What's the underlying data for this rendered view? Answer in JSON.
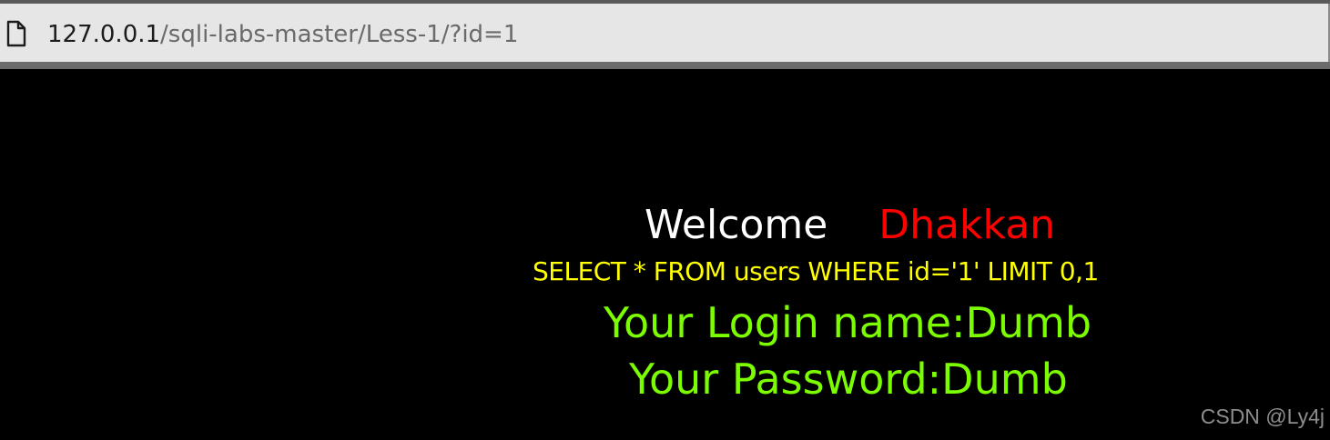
{
  "browser": {
    "url_host": "127.0.0.1",
    "url_path": "/sqli-labs-master/Less-1/?id=1",
    "page_icon": "page-icon"
  },
  "content": {
    "welcome_word": "Welcome",
    "welcome_name": "Dhakkan",
    "query": "SELECT * FROM users WHERE id='1' LIMIT 0,1",
    "login_line": "Your Login name:Dumb",
    "password_line": "Your Password:Dumb"
  },
  "watermark": "CSDN @Ly4j",
  "colors": {
    "background": "#000000",
    "welcome": "#ffffff",
    "name": "#ff0000",
    "query": "#ffff00",
    "result": "#7cfc00"
  }
}
